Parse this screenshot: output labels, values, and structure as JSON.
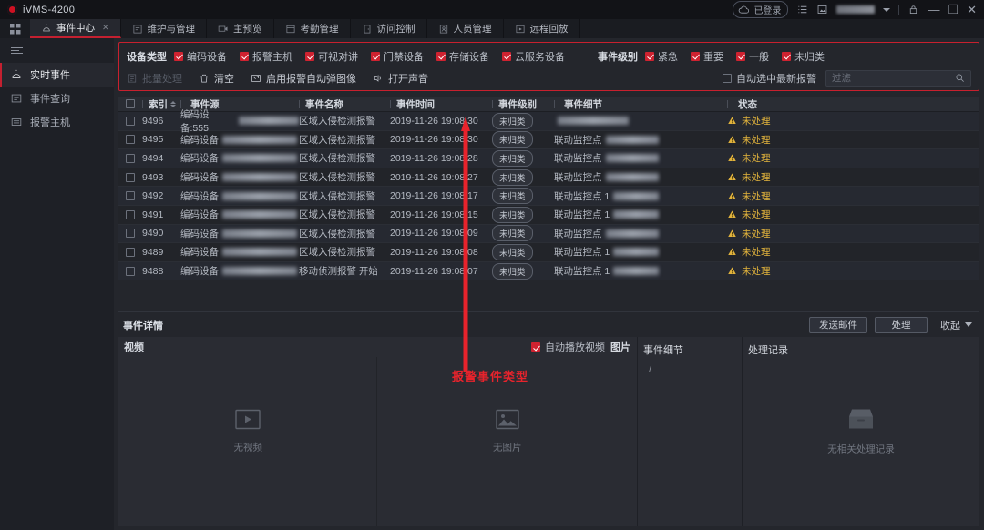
{
  "titlebar": {
    "app_title": "iVMS-4200",
    "cloud_status": "已登录",
    "icons": [
      "cloud-icon",
      "list-icon",
      "screenshot-icon",
      "lock-icon",
      "minimize-icon",
      "maximize-icon",
      "close-icon"
    ],
    "minimize": "—",
    "maximize": "❐",
    "close": "✕"
  },
  "nav": {
    "tabs": [
      {
        "label": "事件中心",
        "active": true,
        "closable": true
      },
      {
        "label": "维护与管理",
        "active": false
      },
      {
        "label": "主预览",
        "active": false
      },
      {
        "label": "考勤管理",
        "active": false
      },
      {
        "label": "访问控制",
        "active": false
      },
      {
        "label": "人员管理",
        "active": false
      },
      {
        "label": "远程回放",
        "active": false
      }
    ]
  },
  "sidebar": {
    "items": [
      {
        "label": "实时事件",
        "active": true
      },
      {
        "label": "事件查询",
        "active": false
      },
      {
        "label": "报警主机",
        "active": false
      }
    ]
  },
  "filter": {
    "device_type_label": "设备类型",
    "device_types": [
      {
        "label": "编码设备",
        "checked": true
      },
      {
        "label": "报警主机",
        "checked": true
      },
      {
        "label": "可视对讲",
        "checked": true
      },
      {
        "label": "门禁设备",
        "checked": true
      },
      {
        "label": "存储设备",
        "checked": true
      },
      {
        "label": "云服务设备",
        "checked": true
      }
    ],
    "event_level_label": "事件级别",
    "event_levels": [
      {
        "label": "紧急",
        "checked": true
      },
      {
        "label": "重要",
        "checked": true
      },
      {
        "label": "一般",
        "checked": true
      },
      {
        "label": "未归类",
        "checked": true
      }
    ],
    "tools": [
      {
        "label": "批量处理",
        "icon": "batch-icon",
        "disabled": true
      },
      {
        "label": "清空",
        "icon": "trash-icon",
        "disabled": false
      },
      {
        "label": "启用报警自动弹图像",
        "icon": "popup-icon",
        "disabled": false
      },
      {
        "label": "打开声音",
        "icon": "sound-icon",
        "disabled": false
      }
    ],
    "auto_select_label": "自动选中最新报警",
    "auto_select_checked": false,
    "search_placeholder": "过滤",
    "search_value": ""
  },
  "table": {
    "columns": [
      "索引",
      "事件源",
      "事件名称",
      "事件时间",
      "事件级别",
      "事件细节",
      "状态"
    ],
    "rows": [
      {
        "index": "9496",
        "source": "编码设备:555",
        "source_blur": 68,
        "name": "区域入侵检测报警",
        "time": "2019-11-26 19:08:30",
        "level": "未归类",
        "detail": "",
        "detail_blur": 78,
        "status": "未处理"
      },
      {
        "index": "9495",
        "source": "编码设备",
        "source_blur": 82,
        "name": "区域入侵检测报警",
        "time": "2019-11-26 19:08:30",
        "level": "未归类",
        "detail": "联动监控点",
        "detail_blur": 58,
        "status": "未处理"
      },
      {
        "index": "9494",
        "source": "编码设备",
        "source_blur": 82,
        "name": "区域入侵检测报警",
        "time": "2019-11-26 19:08:28",
        "level": "未归类",
        "detail": "联动监控点",
        "detail_blur": 58,
        "status": "未处理"
      },
      {
        "index": "9493",
        "source": "编码设备",
        "source_blur": 82,
        "name": "区域入侵检测报警",
        "time": "2019-11-26 19:08:27",
        "level": "未归类",
        "detail": "联动监控点",
        "detail_blur": 58,
        "status": "未处理"
      },
      {
        "index": "9492",
        "source": "编码设备",
        "source_blur": 82,
        "name": "区域入侵检测报警",
        "time": "2019-11-26 19:08:17",
        "level": "未归类",
        "detail": "联动监控点 1",
        "detail_blur": 50,
        "status": "未处理"
      },
      {
        "index": "9491",
        "source": "编码设备",
        "source_blur": 82,
        "name": "区域入侵检测报警",
        "time": "2019-11-26 19:08:15",
        "level": "未归类",
        "detail": "联动监控点 1",
        "detail_blur": 50,
        "status": "未处理"
      },
      {
        "index": "9490",
        "source": "编码设备",
        "source_blur": 82,
        "name": "区域入侵检测报警",
        "time": "2019-11-26 19:08:09",
        "level": "未归类",
        "detail": "联动监控点",
        "detail_blur": 58,
        "status": "未处理"
      },
      {
        "index": "9489",
        "source": "编码设备",
        "source_blur": 82,
        "name": "区域入侵检测报警",
        "time": "2019-11-26 19:08:08",
        "level": "未归类",
        "detail": "联动监控点 1",
        "detail_blur": 50,
        "status": "未处理"
      },
      {
        "index": "9488",
        "source": "编码设备",
        "source_blur": 82,
        "name": "移动侦测报警 开始",
        "time": "2019-11-26 19:08:07",
        "level": "未归类",
        "detail": "联动监控点 1",
        "detail_blur": 50,
        "status": "未处理"
      }
    ]
  },
  "detail": {
    "title": "事件详情",
    "send_mail_label": "发送邮件",
    "handle_label": "处理",
    "collapse_label": "收起",
    "video_label": "视频",
    "autoplay_label": "自动播放视频",
    "autoplay_checked": true,
    "picture_tab_label": "图片",
    "no_video_label": "无视频",
    "no_picture_label": "无图片",
    "event_detail_label": "事件细节",
    "event_detail_value": "/",
    "handle_record_label": "处理记录",
    "no_record_label": "无相关处理记录"
  },
  "annotation": {
    "text": "报警事件类型",
    "color": "#e8232c"
  },
  "colors": {
    "accent_red": "#c8202e",
    "warning_yellow": "#e0b23c",
    "panel_bg": "#24262c",
    "titlebar_bg": "#121317"
  }
}
